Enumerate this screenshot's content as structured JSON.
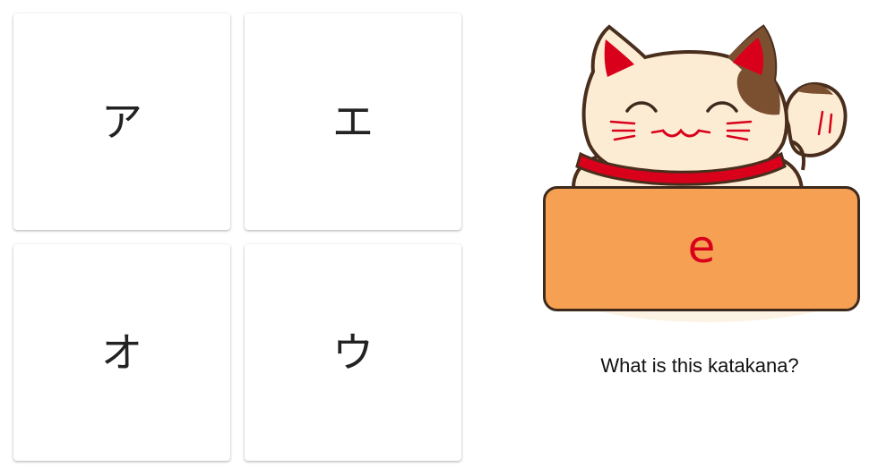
{
  "quiz": {
    "options": [
      {
        "kana": "ア"
      },
      {
        "kana": "エ"
      },
      {
        "kana": "オ"
      },
      {
        "kana": "ウ"
      }
    ],
    "prompt": {
      "romaji": "e",
      "question": "What is this katakana?"
    }
  },
  "mascot": {
    "icon": "maneki-neko-cat-icon",
    "colors": {
      "body": "#fdecd4",
      "outline": "#4a2e1d",
      "ear_inner": "#d9001b",
      "patch": "#7a5030",
      "collar": "#d9001b",
      "sign": "#f5a052"
    }
  }
}
